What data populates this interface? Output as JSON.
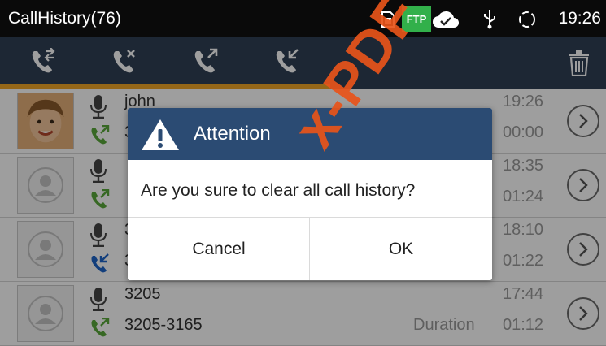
{
  "app": {
    "title": "CallHistory(76)",
    "clock": "19:26",
    "status_icons": [
      "sim-card-icon",
      "ftp-icon",
      "cloud-check-icon",
      "usb-icon",
      "sync-icon"
    ],
    "ftp_label": "FTP"
  },
  "tabs": [
    {
      "name": "all-calls-icon",
      "selected": true
    },
    {
      "name": "missed-calls-icon",
      "selected": false
    },
    {
      "name": "outgoing-calls-icon",
      "selected": false
    },
    {
      "name": "incoming-calls-icon",
      "selected": false
    }
  ],
  "tab_actions": {
    "delete_icon": "trash-icon"
  },
  "calls": [
    {
      "name": "john",
      "number": "3",
      "time": "19:26",
      "duration": "00:00",
      "type": "outgoing",
      "avatar": "photo"
    },
    {
      "name": "",
      "number": "",
      "time": "18:35",
      "duration": "01:24",
      "type": "outgoing",
      "avatar": "default"
    },
    {
      "name": "3",
      "number": "3",
      "time": "18:10",
      "duration": "01:22",
      "type": "incoming",
      "avatar": "default"
    },
    {
      "name": "3205",
      "number": "3205-3165",
      "time": "17:44",
      "duration": "01:12",
      "duration_label": "Duration",
      "type": "outgoing",
      "avatar": "default"
    }
  ],
  "dialog": {
    "title": "Attention",
    "message": "Are you sure to clear all call history?",
    "cancel_label": "Cancel",
    "ok_label": "OK"
  },
  "watermark": "x-PDF",
  "colors": {
    "tab_bar": "#2f3f55",
    "tab_accent": "#f1a628",
    "dialog_header": "#2b4b73",
    "outgoing": "#5aa83a",
    "incoming": "#1d64c8",
    "watermark": "#e8541a"
  }
}
